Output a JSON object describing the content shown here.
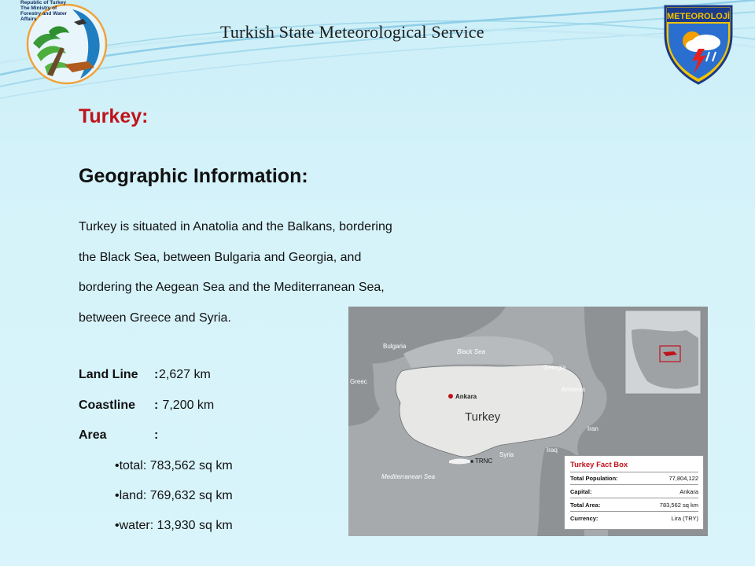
{
  "header": {
    "ministry_logo_text": [
      "Republic of Turkey",
      "The Ministry of",
      "Forestry and Water",
      "Affairs"
    ],
    "title": "Turkish State Meteorological Service",
    "mgm_logo_text": "METEOROLOJİ"
  },
  "content": {
    "heading": "Turkey:",
    "subheading": "Geographic Information:",
    "paragraph_lines": [
      "Turkey is situated in Anatolia and the Balkans, bordering",
      "the Black Sea, between Bulgaria and Georgia, and",
      "bordering the Aegean Sea and the Mediterranean Sea,",
      "between Greece and Syria."
    ],
    "facts": [
      {
        "label": "Land Line",
        "colon": ":",
        "value": "2,627 km"
      },
      {
        "label": "Coastline",
        "colon": ":",
        "value": " 7,200 km"
      },
      {
        "label": "Area",
        "colon": ":",
        "value": ""
      }
    ],
    "area_bullets": [
      "total: 783,562 sq km",
      "land: 769,632 sq km",
      "water: 13,930 sq km"
    ]
  },
  "map": {
    "labels": {
      "bulgaria": "Bulgaria",
      "black_sea": "Black Sea",
      "georgia": "Georgia",
      "armenia": "Armenia",
      "greece": "Greec",
      "ankara": "Ankara",
      "turkey": "Turkey",
      "iran": "Iran",
      "syria": "Syria",
      "iraq": "Iraq",
      "trnc": "TRNC",
      "mediterranean": "Mediterranean Sea"
    },
    "fact_box": {
      "title": "Turkey Fact Box",
      "rows": [
        {
          "key": "Total Population:",
          "value": "77,804,122"
        },
        {
          "key": "Capital:",
          "value": "Ankara"
        },
        {
          "key": "Total Area:",
          "value": "783,562 sq km"
        },
        {
          "key": "Currency:",
          "value": "Lira (TRY)"
        }
      ]
    }
  },
  "colors": {
    "heading_red": "#c0121b",
    "background": "#d6f3fa",
    "map_water": "#a9adb0",
    "map_land": "#8e9295",
    "turkey_land": "#e7e7e5"
  }
}
